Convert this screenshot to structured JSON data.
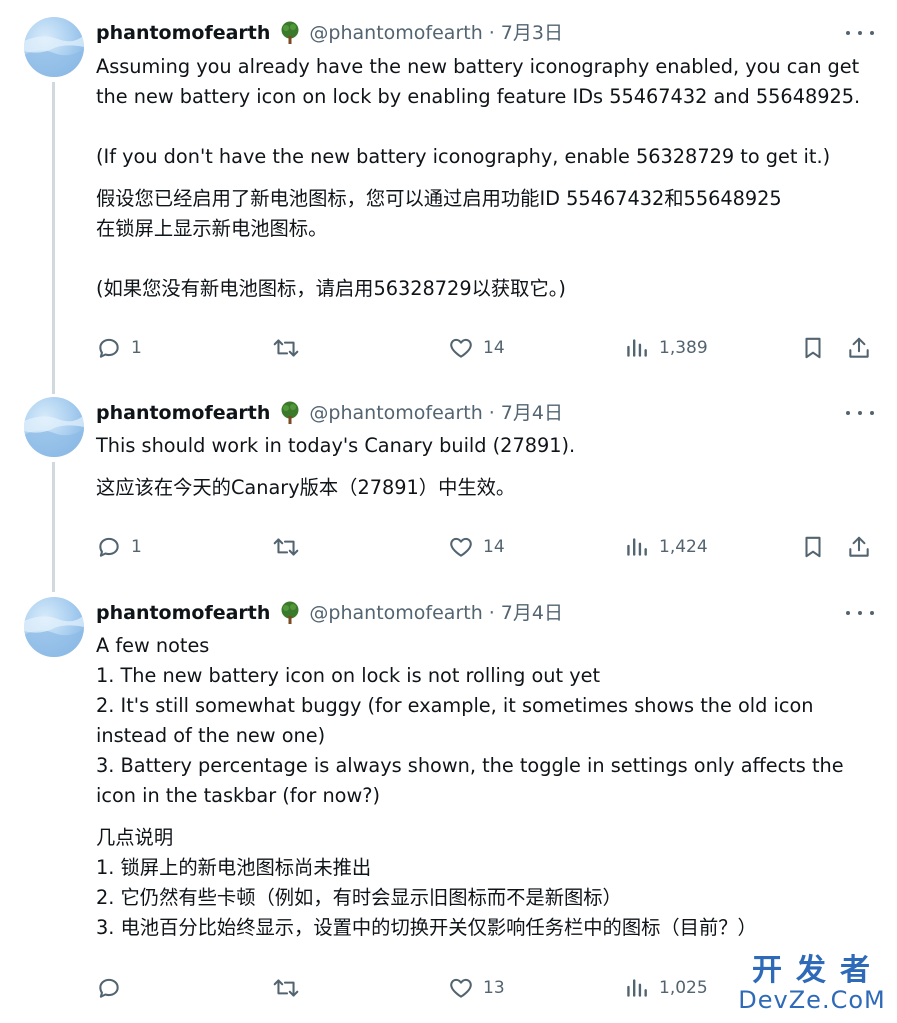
{
  "tweets": [
    {
      "name": "phantomofearth",
      "badge_icon": "tree-icon",
      "handle": "@phantomofearth",
      "separator": "·",
      "date": "7月3日",
      "lines": [
        "Assuming you already have the new battery iconography enabled, you can get",
        "the new battery icon on lock by enabling feature IDs 55467432 and 55648925.",
        "",
        "(If you don't have the new battery iconography, enable 56328729 to get it.)",
        "假设您已经启用了新电池图标，您可以通过启用功能ID 55467432和55648925",
        "在锁屏上显示新电池图标。",
        "",
        "(如果您没有新电池图标，请启用56328729以获取它。)"
      ],
      "replies": "1",
      "reposts": "",
      "likes": "14",
      "views": "1,389"
    },
    {
      "name": "phantomofearth",
      "badge_icon": "tree-icon",
      "handle": "@phantomofearth",
      "separator": "·",
      "date": "7月4日",
      "lines": [
        "This should work in today's Canary build (27891).",
        "这应该在今天的Canary版本（27891）中生效。"
      ],
      "replies": "1",
      "reposts": "",
      "likes": "14",
      "views": "1,424"
    },
    {
      "name": "phantomofearth",
      "badge_icon": "tree-icon",
      "handle": "@phantomofearth",
      "separator": "·",
      "date": "7月4日",
      "lines": [
        "A few notes",
        "1. The new battery icon on lock is not rolling out yet",
        "2. It's still somewhat buggy (for example, it sometimes shows the old icon",
        "instead of the new one)",
        "3. Battery percentage is always shown, the toggle in settings only affects the",
        "icon in the taskbar (for now?)",
        "几点说明",
        "1. 锁屏上的新电池图标尚未推出",
        "2. 它仍然有些卡顿（例如，有时会显示旧图标而不是新图标）",
        "3. 电池百分比始终显示，设置中的切换开关仅影响任务栏中的图标（目前？）"
      ],
      "replies": "",
      "reposts": "",
      "likes": "13",
      "views": "1,025"
    }
  ],
  "watermark": {
    "line1": "开发者",
    "line2": "DevZe.CoM"
  },
  "colors": {
    "text": "#0f1419",
    "secondary": "#536471",
    "thread_line": "#cfd9de",
    "watermark": "#2f6ab8"
  }
}
